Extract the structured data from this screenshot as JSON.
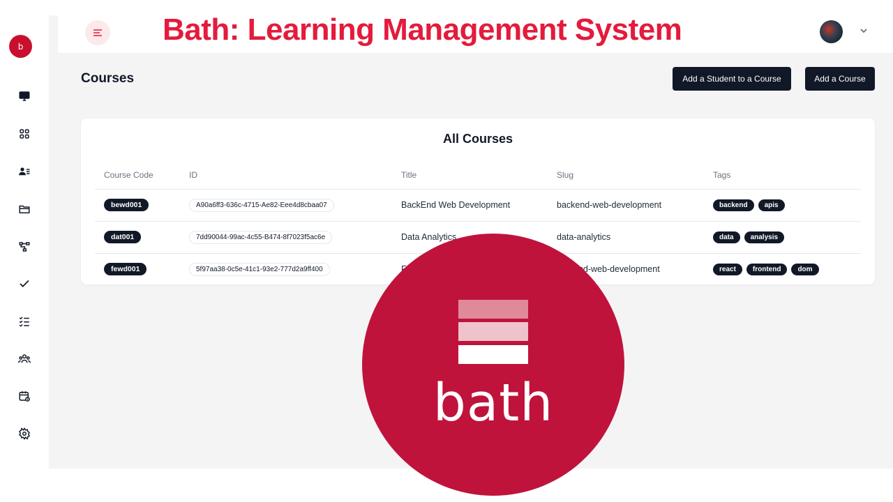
{
  "sidebar": {
    "brand_initial": "b",
    "items": [
      {
        "icon": "monitor-icon"
      },
      {
        "icon": "grid-icon"
      },
      {
        "icon": "user-list-icon"
      },
      {
        "icon": "folders-icon"
      },
      {
        "icon": "hierarchy-icon"
      },
      {
        "icon": "check-icon"
      },
      {
        "icon": "checklist-icon"
      },
      {
        "icon": "users-icon"
      },
      {
        "icon": "calendar-icon"
      },
      {
        "icon": "settings-icon"
      }
    ]
  },
  "header": {
    "title": "Bath: Learning Management System"
  },
  "page": {
    "title": "Courses",
    "add_student_label": "Add a Student to a Course",
    "add_course_label": "Add a Course"
  },
  "courses": {
    "title": "All Courses",
    "columns": [
      "Course Code",
      "ID",
      "Title",
      "Slug",
      "Tags"
    ],
    "rows": [
      {
        "code": "bewd001",
        "id": "A90a6ff3-636c-4715-Ae82-Eee4d8cbaa07",
        "title": "BackEnd Web Development",
        "slug": "backend-web-development",
        "tags": [
          "backend",
          "apis"
        ]
      },
      {
        "code": "dat001",
        "id": "7dd90044-99ac-4c55-B474-8f7023f5ac6e",
        "title": "Data Analytics",
        "slug": "data-analytics",
        "tags": [
          "data",
          "analysis"
        ]
      },
      {
        "code": "fewd001",
        "id": "5f97aa38-0c5e-41c1-93e2-777d2a9ff400",
        "title": "F",
        "slug": "end-web-development",
        "tags": [
          "react",
          "frontend",
          "dom"
        ]
      }
    ]
  },
  "logo": {
    "word": "bath",
    "color": "#bf133c"
  },
  "colors": {
    "accent": "#e31b3c",
    "dark": "#111827"
  }
}
